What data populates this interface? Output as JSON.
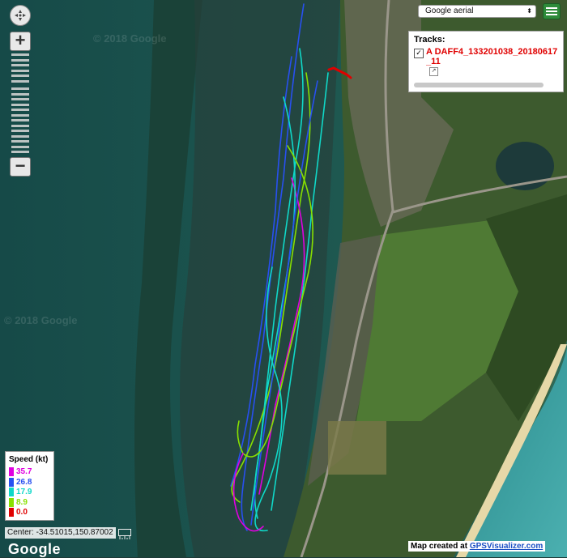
{
  "map_type": {
    "selected": "Google aerial"
  },
  "tracks_panel": {
    "heading": "Tracks:",
    "items": [
      {
        "name": "A DAFF4_133201038_20180617_11",
        "checked": true,
        "color": "#e00000"
      }
    ]
  },
  "legend": {
    "title": "Speed (kt)",
    "entries": [
      {
        "value": "35.7",
        "color": "#e000e0"
      },
      {
        "value": "26.8",
        "color": "#2850f0"
      },
      {
        "value": "17.9",
        "color": "#10d8c8"
      },
      {
        "value": "8.9",
        "color": "#88e000"
      },
      {
        "value": "0.0",
        "color": "#e00000"
      }
    ]
  },
  "center_readout": "Center: -34.51015,150.87002",
  "google_logo": "Google",
  "watermark": "© 2018 Google",
  "credit": {
    "prefix": "Map created at ",
    "link": "GPSVisualizer.com"
  },
  "icons": [
    "pan-icon",
    "zoom-in-icon",
    "zoom-out-icon",
    "menu-icon",
    "ruler-icon",
    "external-link-icon",
    "dropdown-arrow-icon"
  ],
  "colors": {
    "menu_button": "#2e8b3a",
    "track_red": "#e00000",
    "link": "#1a4fc4"
  }
}
